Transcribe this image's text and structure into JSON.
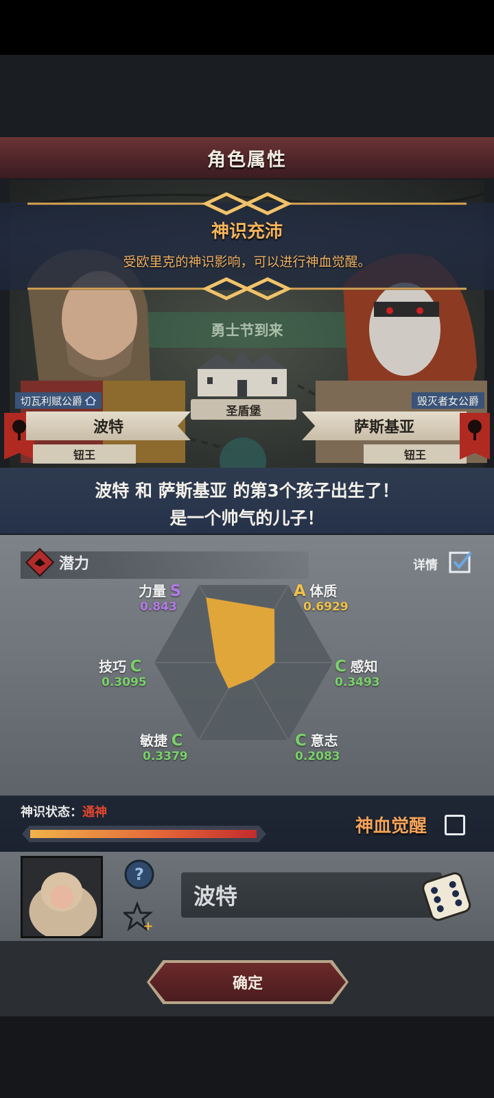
{
  "window": {
    "title": "角色属性"
  },
  "notification": {
    "title": "神识充沛",
    "desc": "受欧里克的神识影响，可以进行神血觉醒。"
  },
  "scene": {
    "event": "勇士节到来",
    "castle_label": "圣盾堡"
  },
  "parents": {
    "left": {
      "title": "切瓦利赋公爵",
      "name": "波特",
      "rank": "钮王"
    },
    "right": {
      "title": "毁灭者女公爵",
      "name": "萨斯基亚",
      "rank": "钮王"
    }
  },
  "birth": {
    "line1": "波特 和 萨斯基亚 的第3个孩子出生了！",
    "line2": "是一个帅气的儿子！"
  },
  "potential": {
    "label": "潜力",
    "detail_label": "详情",
    "stats": [
      {
        "name": "力量",
        "grade": "S",
        "value": "0.843"
      },
      {
        "name": "体质",
        "grade": "A",
        "value": "0.6929"
      },
      {
        "name": "感知",
        "grade": "C",
        "value": "0.3493"
      },
      {
        "name": "意志",
        "grade": "C",
        "value": "0.2083"
      },
      {
        "name": "敏捷",
        "grade": "C",
        "value": "0.3379"
      },
      {
        "name": "技巧",
        "grade": "C",
        "value": "0.3095"
      }
    ],
    "colors": {
      "S": "#b57ae6",
      "A": "#f0c14a",
      "C": "#7bd06a",
      "fill": "#e0a63a"
    }
  },
  "divine": {
    "label": "神识状态：",
    "status": "通神",
    "progress": 1.0,
    "awaken_label": "神血觉醒",
    "awaken_checked": false
  },
  "child": {
    "name": "波特"
  },
  "footer": {
    "confirm_label": "确定"
  }
}
